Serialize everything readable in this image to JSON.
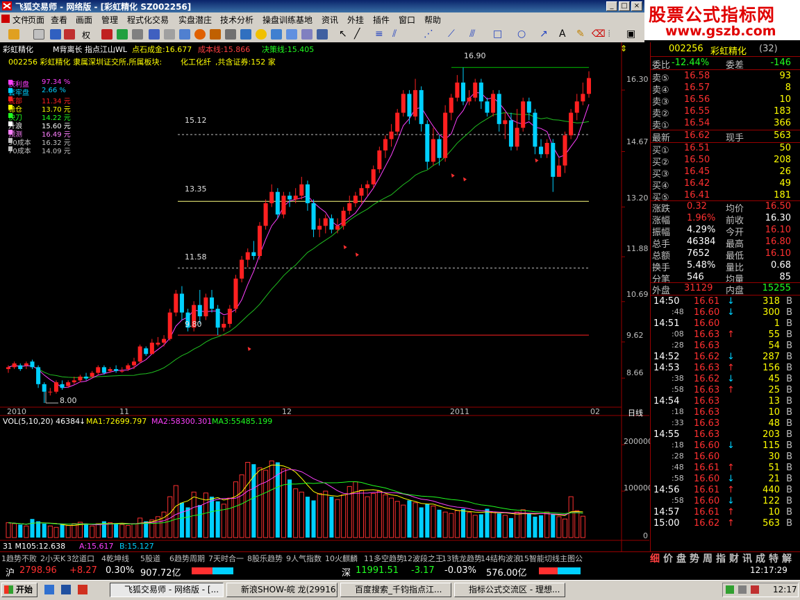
{
  "window": {
    "title": "飞狐交易师 - 网络版 - [彩虹精化 SZ002256]"
  },
  "ad": {
    "line1": "股票公式指标网",
    "line2": "www.gszb.com"
  },
  "menu": [
    "文件",
    "页面",
    "查看",
    "画面",
    "管理",
    "程式化交易",
    "实盘潜庄",
    "技术分析",
    "操盘训练基地",
    "资讯",
    "外挂",
    "插件",
    "窗口",
    "帮助"
  ],
  "toolbar": {
    "mode_label": "权"
  },
  "chart_header": {
    "name": "彩虹精化",
    "indicator": "M背离长 指点江山WL",
    "cost_label": "点石成金:16.677",
    "cost_line": "成本线:15.866",
    "decision_line": "决策线:15.405",
    "info": "002256 彩虹精化 隶属深圳证交所,所属板块:",
    "info_board": "化工化纤",
    "info_tail": ",共含证券:152 家"
  },
  "legend": [
    {
      "label": "获利盘",
      "value": "97.34 %",
      "color": "#ff40ff"
    },
    {
      "label": "套牢盘",
      "value": "2.66 %",
      "color": "#00d0ff"
    },
    {
      "label": "底部",
      "value": "11.34 元",
      "color": "#ff2020"
    },
    {
      "label": "稳仓",
      "value": "13.70 元",
      "color": "#ffff00"
    },
    {
      "label": "快刀",
      "value": "14.22 元",
      "color": "#20ff20"
    },
    {
      "label": "升浪",
      "value": "15.60 元",
      "color": "#ffffff"
    },
    {
      "label": "预测",
      "value": "16.49 元",
      "color": "#ff80ff"
    },
    {
      "label": "90成本",
      "value": "16.32 元",
      "color": "#c0c0c0"
    },
    {
      "label": "70成本",
      "value": "14.09 元",
      "color": "#c0c0c0"
    }
  ],
  "price_axis": [
    "16.30",
    "14.67",
    "13.20",
    "11.88",
    "10.69",
    "9.62",
    "8.66"
  ],
  "date_axis": [
    "2010",
    "11",
    "12",
    "2011",
    "02"
  ],
  "period_label": "日线",
  "levels": [
    {
      "value": "16.90"
    },
    {
      "value": "15.12"
    },
    {
      "value": "13.35"
    },
    {
      "value": "11.58"
    },
    {
      "value": "9.80"
    },
    {
      "value": "8.00"
    }
  ],
  "volume_header": {
    "vol": "VOL(5,10,20) 46384",
    "ma1": "MA1:72699.797",
    "ma2": "MA2:58300.301",
    "ma3": "MA3:55485.199"
  },
  "volume_axis": [
    "200000",
    "100000",
    "0"
  ],
  "sub_header": {
    "m": "31 M105:12.638",
    "a": "A:15.617",
    "b": "B:15.127"
  },
  "chart_data": {
    "type": "candlestick",
    "title": "彩虹精化",
    "ylim": [
      8.0,
      17.2
    ],
    "grid": false,
    "candles": [
      [
        8.9,
        8.95,
        8.8,
        9.0
      ],
      [
        8.95,
        9.05,
        8.9,
        9.1
      ],
      [
        9.0,
        8.9,
        8.85,
        9.05
      ],
      [
        9.0,
        9.05,
        8.9,
        9.1
      ],
      [
        9.1,
        8.95,
        8.9,
        9.15
      ],
      [
        8.95,
        8.5,
        8.4,
        9.0
      ],
      [
        8.5,
        8.3,
        8.0,
        8.55
      ],
      [
        8.3,
        8.3,
        8.2,
        8.4
      ],
      [
        8.3,
        8.55,
        8.25,
        8.6
      ],
      [
        8.5,
        8.4,
        8.35,
        8.6
      ],
      [
        8.45,
        8.55,
        8.4,
        8.6
      ],
      [
        8.55,
        8.6,
        8.5,
        8.7
      ],
      [
        8.6,
        8.7,
        8.55,
        8.75
      ],
      [
        8.7,
        8.65,
        8.6,
        8.8
      ],
      [
        8.7,
        8.8,
        8.65,
        8.85
      ],
      [
        8.8,
        8.95,
        8.75,
        9.0
      ],
      [
        8.95,
        8.8,
        8.75,
        9.0
      ],
      [
        8.85,
        8.9,
        8.8,
        8.95
      ],
      [
        8.9,
        8.85,
        8.8,
        9.0
      ],
      [
        8.85,
        8.85,
        8.8,
        8.95
      ],
      [
        8.9,
        9.0,
        8.85,
        9.05
      ],
      [
        9.0,
        9.1,
        8.9,
        9.2
      ],
      [
        9.1,
        9.5,
        9.05,
        9.55
      ],
      [
        9.45,
        9.3,
        9.25,
        9.5
      ],
      [
        9.3,
        9.6,
        9.3,
        9.7
      ],
      [
        9.55,
        9.6,
        9.5,
        9.75
      ],
      [
        9.6,
        9.7,
        9.5,
        9.8
      ],
      [
        9.7,
        10.4,
        9.65,
        10.5
      ],
      [
        10.4,
        10.9,
        10.3,
        11.0
      ],
      [
        10.9,
        10.4,
        10.2,
        11.1
      ],
      [
        10.4,
        10.0,
        9.9,
        10.5
      ],
      [
        10.0,
        10.6,
        9.9,
        10.7
      ],
      [
        10.6,
        10.3,
        10.1,
        11.0
      ],
      [
        10.3,
        10.8,
        10.2,
        10.9
      ],
      [
        10.8,
        10.5,
        10.4,
        11.0
      ],
      [
        10.5,
        10.0,
        9.8,
        10.6
      ],
      [
        10.0,
        10.1,
        9.9,
        10.3
      ],
      [
        10.1,
        10.5,
        10.0,
        10.6
      ],
      [
        10.5,
        11.3,
        10.4,
        11.4
      ],
      [
        11.3,
        11.8,
        11.2,
        11.9
      ],
      [
        11.8,
        12.0,
        11.6,
        12.1
      ],
      [
        12.0,
        11.9,
        11.8,
        12.3
      ],
      [
        11.9,
        12.7,
        11.8,
        12.8
      ],
      [
        12.7,
        13.3,
        12.6,
        13.4
      ],
      [
        13.3,
        13.6,
        13.2,
        13.8
      ],
      [
        13.6,
        13.0,
        12.9,
        13.7
      ],
      [
        13.0,
        13.5,
        12.9,
        13.6
      ],
      [
        13.5,
        13.4,
        13.2,
        13.6
      ],
      [
        13.4,
        13.5,
        13.3,
        13.7
      ],
      [
        13.5,
        13.8,
        13.4,
        14.0
      ],
      [
        13.8,
        13.3,
        13.1,
        13.9
      ],
      [
        13.3,
        12.6,
        12.4,
        13.4
      ],
      [
        12.6,
        12.7,
        12.4,
        12.9
      ],
      [
        12.7,
        12.9,
        12.5,
        13.0
      ],
      [
        12.9,
        12.6,
        12.5,
        13.0
      ],
      [
        12.6,
        12.7,
        12.5,
        12.9
      ],
      [
        12.7,
        13.1,
        12.6,
        13.2
      ],
      [
        13.1,
        13.3,
        13.0,
        13.5
      ],
      [
        13.3,
        13.5,
        13.2,
        13.6
      ],
      [
        13.5,
        13.7,
        13.3,
        13.8
      ],
      [
        13.7,
        13.8,
        13.5,
        13.9
      ],
      [
        13.8,
        14.2,
        13.7,
        14.3
      ],
      [
        14.2,
        14.7,
        14.1,
        14.8
      ],
      [
        14.7,
        15.0,
        14.5,
        15.1
      ],
      [
        15.0,
        15.2,
        14.8,
        15.4
      ],
      [
        15.2,
        15.7,
        15.1,
        15.8
      ],
      [
        15.7,
        16.2,
        15.6,
        16.3
      ],
      [
        16.2,
        15.6,
        15.4,
        16.3
      ],
      [
        15.6,
        16.3,
        15.5,
        16.6
      ],
      [
        16.3,
        15.4,
        15.2,
        16.4
      ],
      [
        15.4,
        14.4,
        14.2,
        15.5
      ],
      [
        14.4,
        15.0,
        14.3,
        15.3
      ],
      [
        15.0,
        14.5,
        14.3,
        15.1
      ],
      [
        14.5,
        15.7,
        14.4,
        15.9
      ],
      [
        15.7,
        16.1,
        15.5,
        16.2
      ],
      [
        16.1,
        16.5,
        16.0,
        16.7
      ],
      [
        16.5,
        16.0,
        15.9,
        16.9
      ],
      [
        16.0,
        16.1,
        15.9,
        16.3
      ],
      [
        16.1,
        16.5,
        16.0,
        16.6
      ],
      [
        16.5,
        16.0,
        15.8,
        16.6
      ],
      [
        16.0,
        15.7,
        15.6,
        16.1
      ],
      [
        15.7,
        16.2,
        15.6,
        16.3
      ],
      [
        16.2,
        15.4,
        15.2,
        16.3
      ],
      [
        15.4,
        15.5,
        15.0,
        15.7
      ],
      [
        15.5,
        14.8,
        14.7,
        15.7
      ],
      [
        14.8,
        15.3,
        14.7,
        15.8
      ],
      [
        15.3,
        16.0,
        15.2,
        16.1
      ],
      [
        16.0,
        15.7,
        15.5,
        16.1
      ],
      [
        15.7,
        14.8,
        14.6,
        15.8
      ],
      [
        14.8,
        14.6,
        14.5,
        15.0
      ],
      [
        14.6,
        14.9,
        14.5,
        15.0
      ],
      [
        14.9,
        14.0,
        13.6,
        15.0
      ],
      [
        14.0,
        14.3,
        14.0,
        14.5
      ],
      [
        14.3,
        15.1,
        14.1,
        15.2
      ],
      [
        15.1,
        15.7,
        15.0,
        15.8
      ],
      [
        15.7,
        16.0,
        15.5,
        16.2
      ],
      [
        16.0,
        16.2,
        15.9,
        16.5
      ],
      [
        16.2,
        16.62,
        16.1,
        16.8
      ]
    ],
    "volume": [
      32,
      30,
      28,
      25,
      40,
      35,
      30,
      25,
      22,
      28,
      26,
      30,
      33,
      28,
      25,
      30,
      35,
      32,
      30,
      28,
      26,
      30,
      42,
      35,
      38,
      45,
      55,
      88,
      112,
      75,
      65,
      98,
      70,
      96,
      88,
      78,
      72,
      85,
      120,
      135,
      162,
      158,
      150,
      145,
      165,
      162,
      148,
      125,
      105,
      98,
      88,
      80,
      95,
      100,
      88,
      82,
      92,
      110,
      120,
      102,
      88,
      95,
      100,
      92,
      85,
      78,
      70,
      80,
      75,
      65,
      72,
      68,
      60,
      55,
      52,
      58,
      62,
      54,
      48,
      50,
      62,
      55,
      52,
      48,
      42,
      55,
      60,
      52,
      45,
      48,
      55,
      50,
      45,
      40,
      88,
      58,
      46
    ],
    "ma_curves": {
      "ma5_color": "#ff40ff",
      "ma20_color": "#20c020"
    },
    "vol_ma_colors": [
      "#ffffff",
      "#ffff00",
      "#ff40ff",
      "#20ff20"
    ]
  },
  "quote": {
    "code": "002256",
    "name": "彩虹精化",
    "count": "(32)",
    "weibi_label": "委比",
    "weibi": "-12.44%",
    "weicha_label": "委差",
    "weicha": "-146",
    "asks": [
      {
        "label": "卖⑤",
        "price": "16.58",
        "vol": "93"
      },
      {
        "label": "卖④",
        "price": "16.57",
        "vol": "8"
      },
      {
        "label": "卖③",
        "price": "16.56",
        "vol": "10"
      },
      {
        "label": "卖②",
        "price": "16.55",
        "vol": "183"
      },
      {
        "label": "卖①",
        "price": "16.54",
        "vol": "366"
      }
    ],
    "last_label": "最新",
    "last": "16.62",
    "cur_label": "现手",
    "cur": "563",
    "bids": [
      {
        "label": "买①",
        "price": "16.51",
        "vol": "50"
      },
      {
        "label": "买②",
        "price": "16.50",
        "vol": "208"
      },
      {
        "label": "买③",
        "price": "16.45",
        "vol": "26"
      },
      {
        "label": "买④",
        "price": "16.42",
        "vol": "49"
      },
      {
        "label": "买⑤",
        "price": "16.41",
        "vol": "181"
      }
    ],
    "stats": [
      {
        "l1": "涨跌",
        "v1": "0.32",
        "c1": "#ff3030",
        "l2": "均价",
        "v2": "16.50",
        "c2": "#ff3030"
      },
      {
        "l1": "涨幅",
        "v1": "1.96%",
        "c1": "#ff3030",
        "l2": "前收",
        "v2": "16.30",
        "c2": "#ffffff"
      },
      {
        "l1": "振幅",
        "v1": "4.29%",
        "c1": "#ffffff",
        "l2": "今开",
        "v2": "16.10",
        "c2": "#ff3030"
      },
      {
        "l1": "总手",
        "v1": "46384",
        "c1": "#ffffff",
        "l2": "最高",
        "v2": "16.80",
        "c2": "#ff3030"
      },
      {
        "l1": "总额",
        "v1": "7652",
        "c1": "#ffffff",
        "l2": "最低",
        "v2": "16.10",
        "c2": "#ff3030"
      },
      {
        "l1": "换手",
        "v1": "5.48%",
        "c1": "#ffffff",
        "l2": "量比",
        "v2": "0.68",
        "c2": "#ffffff"
      },
      {
        "l1": "分笔",
        "v1": "546",
        "c1": "#ffffff",
        "l2": "均量",
        "v2": "85",
        "c2": "#ffffff"
      }
    ],
    "outer_label": "外盘",
    "outer": "31129",
    "inner_label": "内盘",
    "inner": "15255"
  },
  "ticks": [
    {
      "time": "14:50",
      "price": "16.61",
      "dir": "↓",
      "vol": "318",
      "bs": "B"
    },
    {
      "time": ":48",
      "price": "16.60",
      "dir": "↓",
      "vol": "300",
      "bs": "B"
    },
    {
      "time": "14:51",
      "price": "16.60",
      "dir": "",
      "vol": "1",
      "bs": "B"
    },
    {
      "time": ":08",
      "price": "16.63",
      "dir": "↑",
      "vol": "55",
      "bs": "B"
    },
    {
      "time": ":28",
      "price": "16.63",
      "dir": "",
      "vol": "54",
      "bs": "B"
    },
    {
      "time": "14:52",
      "price": "16.62",
      "dir": "↓",
      "vol": "287",
      "bs": "B"
    },
    {
      "time": "14:53",
      "price": "16.63",
      "dir": "↑",
      "vol": "156",
      "bs": "B"
    },
    {
      "time": ":38",
      "price": "16.62",
      "dir": "↓",
      "vol": "45",
      "bs": "B"
    },
    {
      "time": ":58",
      "price": "16.63",
      "dir": "↑",
      "vol": "25",
      "bs": "B"
    },
    {
      "time": "14:54",
      "price": "16.63",
      "dir": "",
      "vol": "13",
      "bs": "B"
    },
    {
      "time": ":18",
      "price": "16.63",
      "dir": "",
      "vol": "10",
      "bs": "B"
    },
    {
      "time": ":33",
      "price": "16.63",
      "dir": "",
      "vol": "48",
      "bs": "B"
    },
    {
      "time": "14:55",
      "price": "16.63",
      "dir": "",
      "vol": "203",
      "bs": "B"
    },
    {
      "time": ":18",
      "price": "16.60",
      "dir": "↓",
      "vol": "115",
      "bs": "B"
    },
    {
      "time": ":28",
      "price": "16.60",
      "dir": "",
      "vol": "30",
      "bs": "B"
    },
    {
      "time": ":48",
      "price": "16.61",
      "dir": "↑",
      "vol": "51",
      "bs": "B"
    },
    {
      "time": ":58",
      "price": "16.60",
      "dir": "↓",
      "vol": "21",
      "bs": "B"
    },
    {
      "time": "14:56",
      "price": "16.61",
      "dir": "↑",
      "vol": "440",
      "bs": "B"
    },
    {
      "time": ":58",
      "price": "16.60",
      "dir": "↓",
      "vol": "122",
      "bs": "B"
    },
    {
      "time": "14:57",
      "price": "16.61",
      "dir": "↑",
      "vol": "10",
      "bs": "B"
    },
    {
      "time": "15:00",
      "price": "16.62",
      "dir": "↑",
      "vol": "563",
      "bs": "B"
    }
  ],
  "bottom_tabs": [
    "1趋势不败",
    "2小天K",
    "3岔道口",
    "4乾坤线",
    "5股道",
    "6趋势周期",
    "7天时合一",
    "8股乐趋势",
    "9人气指数",
    "10火麒麟",
    "11多空趋势",
    "12波段之王",
    "13铣龙趋势",
    "14结构波浪",
    "15智能切线主图公"
  ],
  "right_tabs": [
    "细",
    "价",
    "盘",
    "势",
    "周",
    "指",
    "财",
    "讯",
    "成",
    "特",
    "解"
  ],
  "indexbar": {
    "sh_label": "沪",
    "sh_idx": "2798.96",
    "sh_chg": "+8.27",
    "sh_pct": "0.30%",
    "sh_amt": "907.72亿",
    "sz_label": "深",
    "sz_idx": "11991.51",
    "sz_chg": "-3.17",
    "sz_pct": "-0.03%",
    "sz_amt": "576.00亿",
    "clock": "12:17:29"
  },
  "taskbar": {
    "start": "开始",
    "tasks": [
      "飞狐交易师 - 网络版 - [...",
      "新浪SHOW-皖 龙(29916...",
      "百度搜索_千钧指点江...",
      "指标公式交流区 - 理想..."
    ],
    "time": "12:17"
  }
}
